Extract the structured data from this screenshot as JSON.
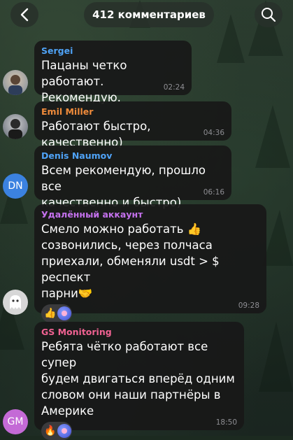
{
  "header": {
    "title": "412 комментариев",
    "back_icon": "chevron-left-icon",
    "search_icon": "search-icon"
  },
  "messages": [
    {
      "name": "Sergei",
      "name_color": "#4fa3f7",
      "lines": [
        "Пацаны четко работают.",
        "Рекомендую."
      ],
      "time": "02:24",
      "avatar": "photo"
    },
    {
      "name": "Emil Miller",
      "name_color": "#ef8b3b",
      "lines": [
        "Работают быстро, качественно)"
      ],
      "time": "04:36",
      "avatar": "photo"
    },
    {
      "name": "Denis Naumov",
      "name_color": "#4fa3f7",
      "lines": [
        "Всем рекомендую, прошло все",
        "качественно и быстро)"
      ],
      "time": "06:16",
      "avatar_initials": "DN",
      "avatar_color": "#3b82e0"
    },
    {
      "name": "Удалённый аккаунт",
      "name_color": "#c471ed",
      "lines": [
        "Смело можно работать 👍",
        "созвонились, через полчаса",
        "приехали, обменяли usdt > $ респект",
        "парни🤝"
      ],
      "time": "09:28",
      "avatar": "ghost",
      "reaction_emoji": "👍"
    },
    {
      "name": "GS Monitoring",
      "name_color": "#f06292",
      "lines": [
        "Ребята чётко работают все супер",
        "будем двигаться вперёд одним",
        "словом они наши партнёры в",
        "Америке"
      ],
      "time": "18:50",
      "avatar_initials": "GM",
      "avatar_color": "#c46ad6",
      "reaction_emoji": "🔥"
    }
  ]
}
